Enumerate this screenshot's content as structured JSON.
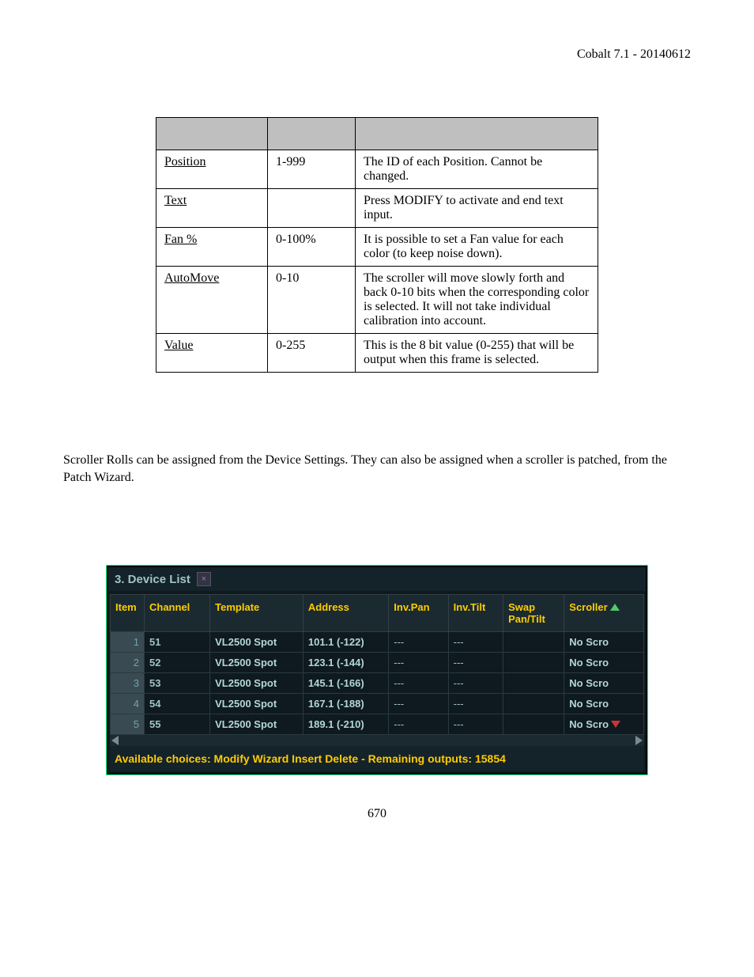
{
  "header": "Cobalt 7.1 - 20140612",
  "param_table": {
    "rows": [
      {
        "name": "Position",
        "range": "1-999",
        "desc": "The ID of each Position. Cannot be changed."
      },
      {
        "name": "Text",
        "range": "",
        "desc": "Press MODIFY to activate and end text input."
      },
      {
        "name": "Fan %",
        "range": "0-100%",
        "desc": "It is possible to set a Fan value for each color (to keep noise down)."
      },
      {
        "name": "AutoMove",
        "range": "0-10",
        "desc": "The scroller will move slowly forth and back 0-10 bits when the corresponding color is selected. It will not take individual calibration into account."
      },
      {
        "name": "Value",
        "range": "0-255",
        "desc": "This is the 8 bit value (0-255) that will be output when this frame is selected."
      }
    ]
  },
  "body_paragraph": "Scroller Rolls can be assigned from the Device Settings. They can also be assigned when a scroller is patched, from the Patch Wizard.",
  "device_list": {
    "title": "3. Device List",
    "columns": [
      "Item",
      "Channel",
      "Template",
      "Address",
      "Inv.Pan",
      "Inv.Tilt",
      "Swap Pan/Tilt",
      "Scroller"
    ],
    "rows": [
      {
        "item": "1",
        "channel": "51",
        "template": "VL2500 Spot",
        "address": "101.1 (-122)",
        "invpan": "---",
        "invtilt": "---",
        "swap": "",
        "scroller": "No Scro"
      },
      {
        "item": "2",
        "channel": "52",
        "template": "VL2500 Spot",
        "address": "123.1 (-144)",
        "invpan": "---",
        "invtilt": "---",
        "swap": "",
        "scroller": "No Scro"
      },
      {
        "item": "3",
        "channel": "53",
        "template": "VL2500 Spot",
        "address": "145.1 (-166)",
        "invpan": "---",
        "invtilt": "---",
        "swap": "",
        "scroller": "No Scro"
      },
      {
        "item": "4",
        "channel": "54",
        "template": "VL2500 Spot",
        "address": "167.1 (-188)",
        "invpan": "---",
        "invtilt": "---",
        "swap": "",
        "scroller": "No Scro"
      },
      {
        "item": "5",
        "channel": "55",
        "template": "VL2500 Spot",
        "address": "189.1 (-210)",
        "invpan": "---",
        "invtilt": "---",
        "swap": "",
        "scroller": "No Scro"
      }
    ],
    "status": "Available choices: Modify Wizard Insert Delete  - Remaining outputs: 15854"
  },
  "page_number": "670"
}
